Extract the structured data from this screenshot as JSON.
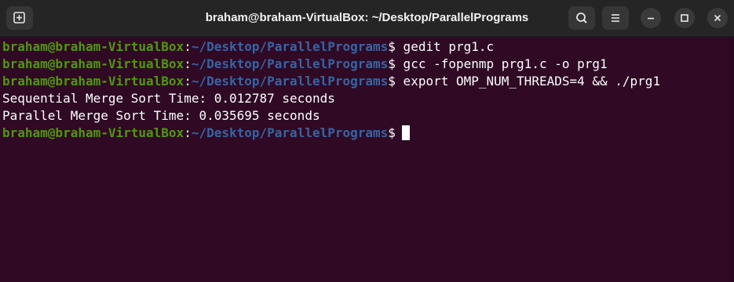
{
  "window": {
    "title": "braham@braham-VirtualBox: ~/Desktop/ParallelPrograms"
  },
  "titlebar_buttons": {
    "new_tab": "new-tab-icon",
    "search": "search-icon",
    "menu": "hamburger-menu-icon",
    "minimize": "minimize-icon",
    "maximize": "maximize-icon",
    "close": "close-icon"
  },
  "colors": {
    "background": "#300a24",
    "prompt_user": "#4e9a06",
    "prompt_path": "#3465a4",
    "text": "#ffffff",
    "titlebar": "#252525"
  },
  "prompt": {
    "user_host": "braham@braham-VirtualBox",
    "colon": ":",
    "path": "~/Desktop/ParallelPrograms",
    "symbol": "$"
  },
  "terminal": {
    "commands": [
      " gedit prg1.c",
      " gcc -fopenmp prg1.c -o prg1",
      " export OMP_NUM_THREADS=4 && ./prg1"
    ],
    "outputs": [
      "Sequential Merge Sort Time: 0.012787 seconds",
      "Parallel Merge Sort Time: 0.035695 seconds"
    ]
  }
}
